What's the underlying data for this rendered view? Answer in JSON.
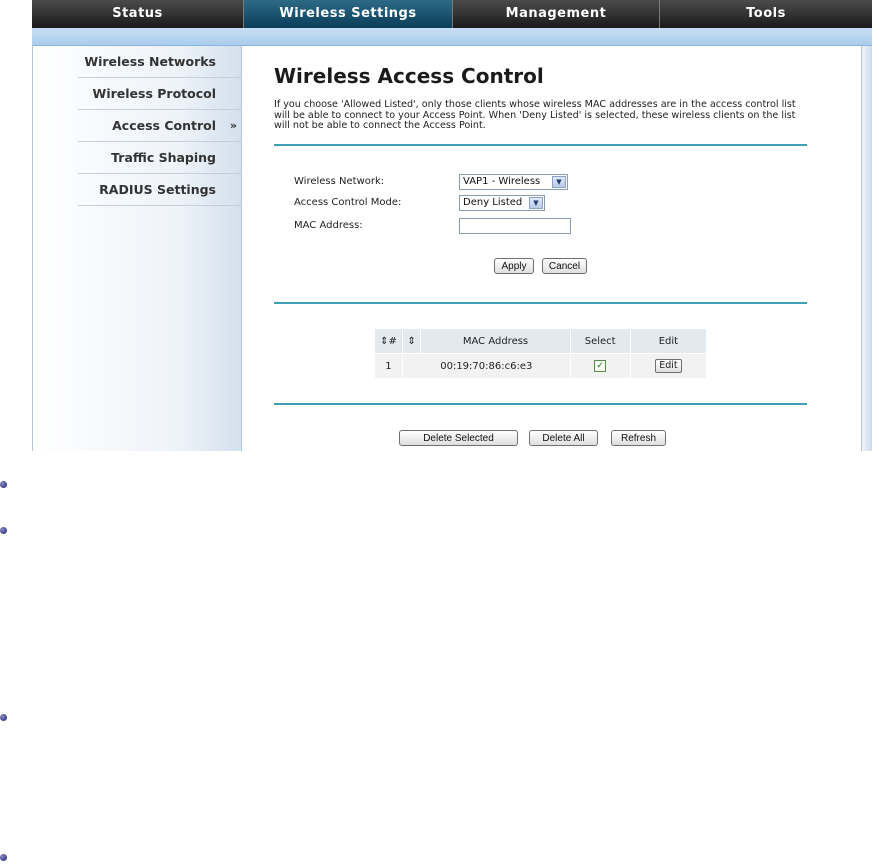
{
  "nav": {
    "tabs": [
      {
        "label": "Status",
        "active": false
      },
      {
        "label": "Wireless Settings",
        "active": true
      },
      {
        "label": "Management",
        "active": false
      },
      {
        "label": "Tools",
        "active": false
      }
    ]
  },
  "sidebar": {
    "items": [
      {
        "label": "Wireless Networks"
      },
      {
        "label": "Wireless Protocol"
      },
      {
        "label": "Access Control",
        "active": true,
        "arrow": "»"
      },
      {
        "label": "Traffic Shaping"
      },
      {
        "label": "RADIUS Settings"
      }
    ]
  },
  "main": {
    "title": "Wireless Access Control",
    "description": "If you choose 'Allowed Listed', only those clients whose wireless MAC addresses are in the access control list will be able to connect to your Access Point. When 'Deny Listed' is selected, these wireless clients on the list will not be able to connect the Access Point.",
    "form": {
      "network_label": "Wireless Network:",
      "network_value": "VAP1 - Wireless",
      "mode_label": "Access Control Mode:",
      "mode_value": "Deny Listed",
      "mac_label": "MAC Address:",
      "mac_value": "",
      "apply_label": "Apply",
      "cancel_label": "Cancel"
    },
    "table": {
      "headers": [
        "⇕#",
        "⇕",
        "MAC Address",
        "Select",
        "Edit"
      ],
      "rows": [
        {
          "num": "1",
          "mac": "00:19:70:86:c6:e3",
          "selected": true,
          "edit_label": "Edit"
        }
      ]
    },
    "actions": {
      "delete_selected_label": "Delete Selected",
      "delete_all_label": "Delete All",
      "refresh_label": "Refresh"
    }
  },
  "colors": {
    "divider": "#3fa1b4",
    "active_tab": "#0b3d5a",
    "subbar": "#b3d1ef"
  }
}
